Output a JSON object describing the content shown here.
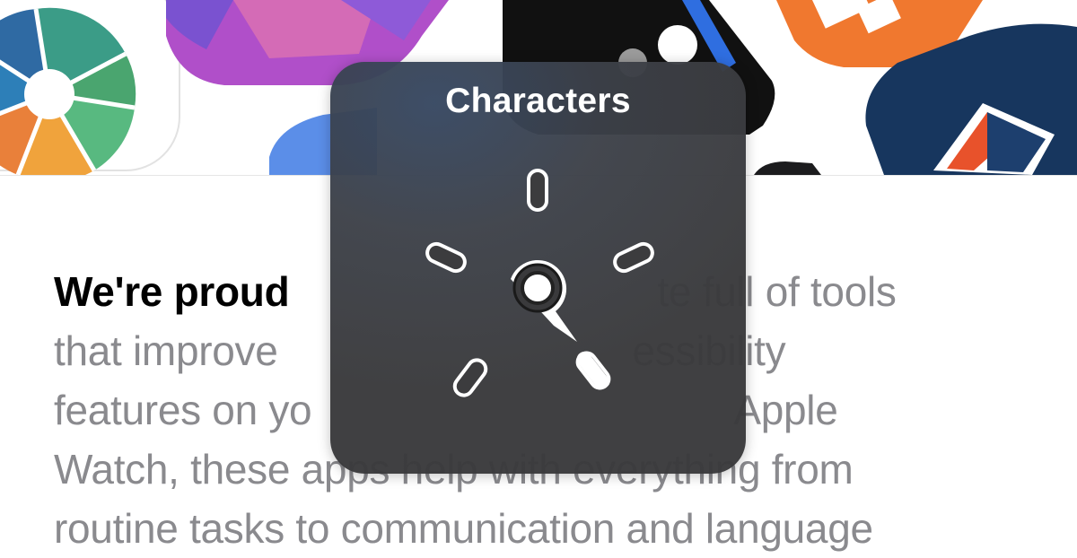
{
  "rotor": {
    "title": "Characters",
    "dial_icon": "rotor-dial-icon"
  },
  "article": {
    "lead": "We're proud",
    "line1_rest": "te full of tools",
    "line2_start": "that improve",
    "line2_end": "essibility",
    "line3_start": "features on yo",
    "line3_end": "Apple",
    "line4": "Watch, these apps help with everything from",
    "line5": "routine tasks to communication and language"
  },
  "colors": {
    "text_gray": "#8a8a8e",
    "text_black": "#000000",
    "hud_background": "#3a3a3c"
  },
  "icons": [
    "camera-shutter-app-icon",
    "shortcuts-app-icon",
    "black-app-icon",
    "orange-app-icon",
    "blue-app-icon",
    "navy-tent-app-icon"
  ]
}
